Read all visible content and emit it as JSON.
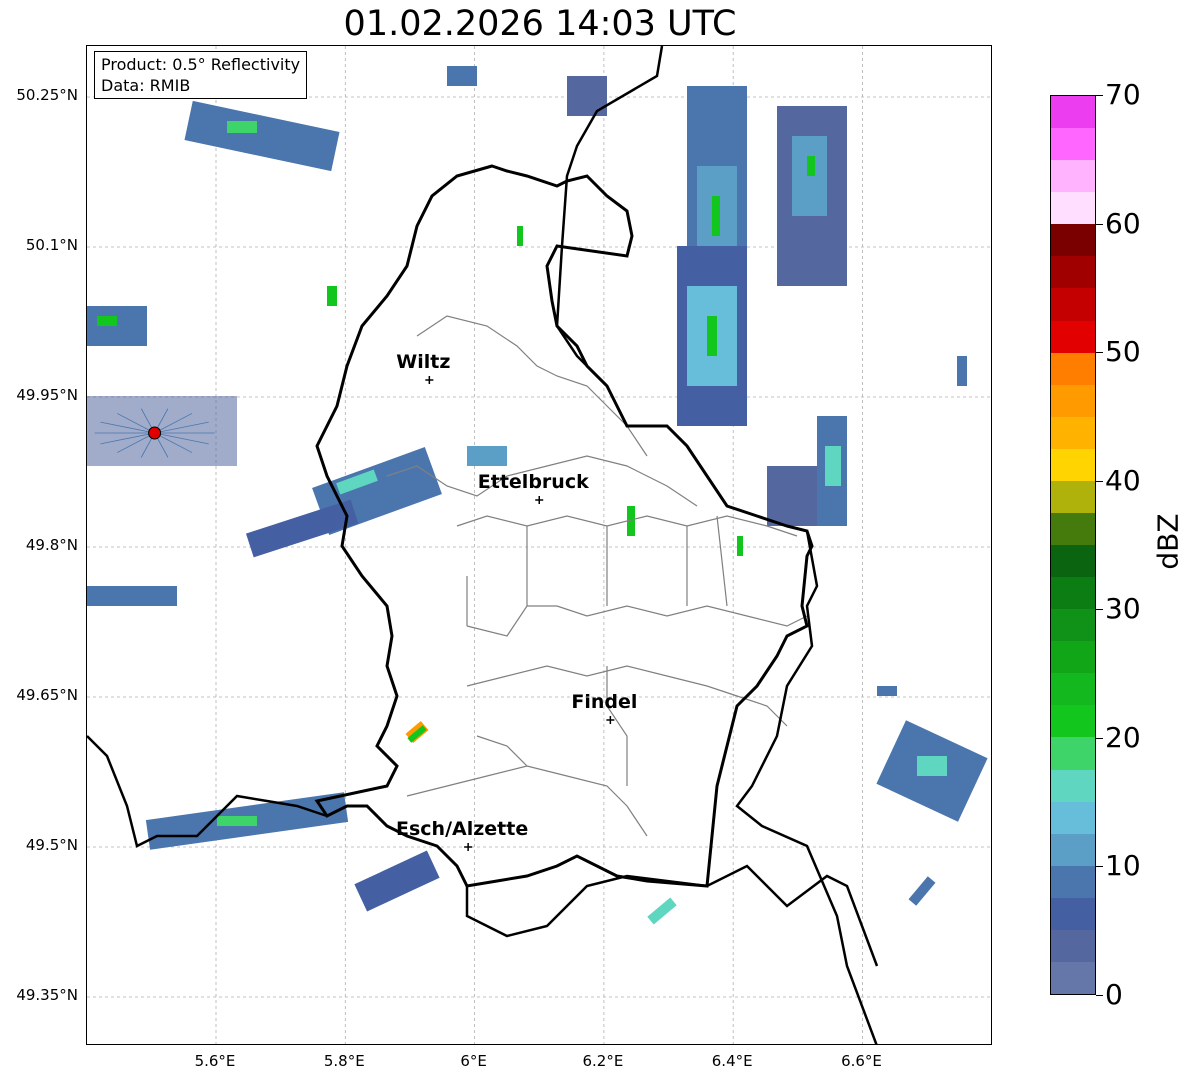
{
  "title": "01.02.2026 14:03 UTC",
  "info": {
    "product": "Product: 0.5° Reflectivity",
    "data": "Data: RMIB"
  },
  "lat_ticks": [
    {
      "value": 50.25,
      "label": "50.25°N"
    },
    {
      "value": 50.1,
      "label": "50.1°N"
    },
    {
      "value": 49.95,
      "label": "49.95°N"
    },
    {
      "value": 49.8,
      "label": "49.8°N"
    },
    {
      "value": 49.65,
      "label": "49.65°N"
    },
    {
      "value": 49.5,
      "label": "49.5°N"
    },
    {
      "value": 49.35,
      "label": "49.35°N"
    }
  ],
  "lon_ticks": [
    {
      "value": 5.6,
      "label": "5.6°E"
    },
    {
      "value": 5.8,
      "label": "5.8°E"
    },
    {
      "value": 6.0,
      "label": "6°E"
    },
    {
      "value": 6.2,
      "label": "6.2°E"
    },
    {
      "value": 6.4,
      "label": "6.4°E"
    },
    {
      "value": 6.6,
      "label": "6.6°E"
    }
  ],
  "cities": [
    {
      "name": "Wiltz",
      "lon": 5.93,
      "lat": 49.967
    },
    {
      "name": "Ettelbruck",
      "lon": 6.1,
      "lat": 49.847
    },
    {
      "name": "Findel",
      "lon": 6.21,
      "lat": 49.627
    },
    {
      "name": "Esch/Alzette",
      "lon": 5.99,
      "lat": 49.5
    }
  ],
  "radar_site": {
    "lon": 5.505,
    "lat": 49.914,
    "color": "#e00000"
  },
  "colorbar": {
    "label": "dBZ",
    "min": 0,
    "max": 70,
    "tick_values": [
      0,
      10,
      20,
      30,
      40,
      50,
      60,
      70
    ],
    "tick_labels": [
      "0",
      "10",
      "20",
      "30",
      "40",
      "50",
      "60",
      "70"
    ],
    "colors": [
      "#6477a8",
      "#54689f",
      "#4460a2",
      "#4a76ad",
      "#5b9ec6",
      "#66bedb",
      "#5fd6c0",
      "#3fd46a",
      "#12c61d",
      "#13b81e",
      "#11a617",
      "#0f9217",
      "#0b7d12",
      "#0a6410",
      "#457b0d",
      "#aeb20a",
      "#ffd400",
      "#ffb300",
      "#ff9a00",
      "#ff7e00",
      "#e30000",
      "#c40000",
      "#a00000",
      "#7a0000",
      "#ffdeff",
      "#ffb3ff",
      "#ff66ff",
      "#ec3ef0"
    ]
  }
}
